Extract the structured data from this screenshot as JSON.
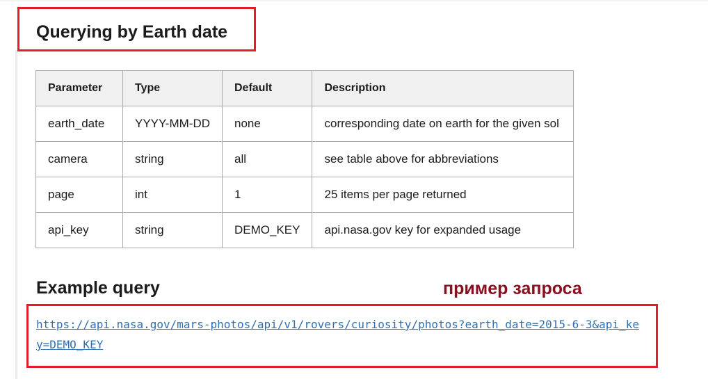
{
  "section": {
    "title": "Querying by Earth date"
  },
  "table": {
    "headers": {
      "parameter": "Parameter",
      "type": "Type",
      "default": "Default",
      "description": "Description"
    },
    "rows": [
      {
        "parameter": "earth_date",
        "type": "YYYY-MM-DD",
        "default": "none",
        "description": "corresponding date on earth for the given sol"
      },
      {
        "parameter": "camera",
        "type": "string",
        "default": "all",
        "description": "see table above for abbreviations"
      },
      {
        "parameter": "page",
        "type": "int",
        "default": "1",
        "description": "25 items per page returned"
      },
      {
        "parameter": "api_key",
        "type": "string",
        "default": "DEMO_KEY",
        "description": "api.nasa.gov key for expanded usage"
      }
    ]
  },
  "example": {
    "heading": "Example query",
    "url": "https://api.nasa.gov/mars-photos/api/v1/rovers/curiosity/photos?earth_date=2015-6-3&api_key=DEMO_KEY"
  },
  "annotation": {
    "text": "пример запроса"
  },
  "colors": {
    "highlight_border": "#e21d2b",
    "annotation_text": "#8a1020",
    "link": "#2f6fb1",
    "table_header_bg": "#f0f0f0",
    "table_border": "#a9a9a9"
  }
}
